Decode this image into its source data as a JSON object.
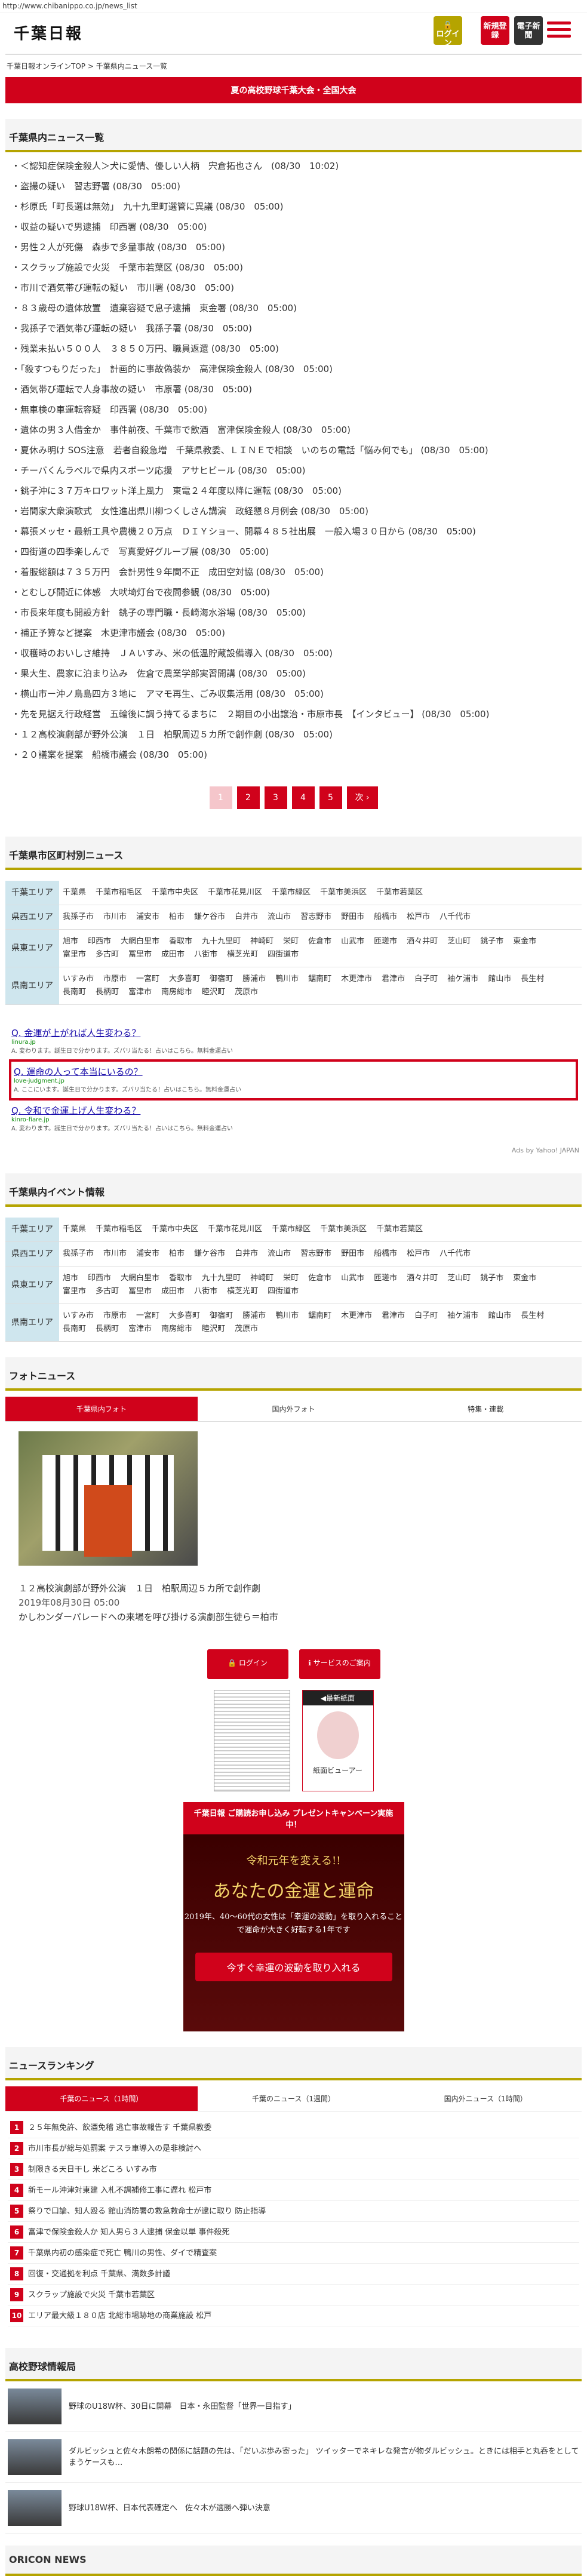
{
  "url": "http://www.chibanippo.co.jp/news_list",
  "header": {
    "logo": "千葉日報",
    "login": "ログイン",
    "register": "新規登録",
    "epaper": "電子新聞"
  },
  "breadcrumb": "千葉日報オンラインTOP > 千葉県内ニュース一覧",
  "banner": "夏の高校野球千葉大会・全国大会",
  "news_section": {
    "title": "千葉県内ニュース一覧",
    "items": [
      "＜認知症保険金殺人＞犬に愛情、優しい人柄　宍倉拓也さん　(08/30　10:02)",
      "盗撮の疑い　習志野署 (08/30　05:00)",
      "杉原氏「町長選は無効」　九十九里町選管に異議 (08/30　05:00)",
      "収益の疑いで男逮捕　印西署 (08/30　05:00)",
      "男性２人が死傷　森歩で多量事故 (08/30　05:00)",
      "スクラップ施設で火災　千葉市若葉区 (08/30　05:00)",
      "市川で酒気帯び運転の疑い　市川署 (08/30　05:00)",
      "８３歳母の遺体放置　遺棄容疑で息子逮捕　東金署 (08/30　05:00)",
      "我孫子で酒気帯び運転の疑い　我孫子署 (08/30　05:00)",
      "残業未払い５００人　３８５０万円、職員返還 (08/30　05:00)",
      "「殺すつもりだった」　計画的に事故偽装か　高津保険金殺人 (08/30　05:00)",
      "酒気帯び運転で人身事故の疑い　市原署 (08/30　05:00)",
      "無車検の車運転容疑　印西署 (08/30　05:00)",
      "遺体の男３人借金か　事件前夜、千葉市で飲酒　富津保険金殺人 (08/30　05:00)",
      "夏休み明け SOS注意　若者自殺急増　千葉県教委、ＬＩＮＥで相談　いのちの電話「悩み何でも」 (08/30　05:00)",
      "チーバくんラベルで県内スポーツ応援　アサヒビール (08/30　05:00)",
      "銚子沖に３７万キロワット洋上風力　東電２４年度以降に運転 (08/30　05:00)",
      "岩間家大衆演歌式　女性進出県川柳つくしさん講演　政経懇８月例会 (08/30　05:00)",
      "幕張メッセ・最新工具や農機２０万点　ＤＩＹショー、開幕４８５社出展　一般入場３０日から (08/30　05:00)",
      "四街道の四季楽しんで　写真愛好グループ展 (08/30　05:00)",
      "着服総額は７３５万円　会計男性９年間不正　成田空対協 (08/30　05:00)",
      "とむしび間近に体感　大吠埼灯台で夜間参観 (08/30　05:00)",
      "市長来年度も開設方針　銚子の専門職・長崎海水浴場 (08/30　05:00)",
      "補正予算など提案　木更津市議会 (08/30　05:00)",
      "収穫時のおいしさ維持　ＪＡいすみ、米の低温貯蔵設備導入 (08/30　05:00)",
      "果大生、農家に泊まり込み　佐倉で農業学部実習開講 (08/30　05:00)",
      "横山市ー沖ノ鳥島四方３地に　アマモ再生、ごみ収集活用 (08/30　05:00)",
      "先を見据え行政経営　五輪後に調う持てるまちに　２期目の小出譲治・市原市長　【インタビュー】 (08/30　05:00)",
      "１２高校演劇部が野外公演　１日　柏駅周辺５カ所で創作劇 (08/30　05:00)",
      "２０議案を提案　船橋市議会 (08/30　05:00)"
    ]
  },
  "pager": {
    "pages": [
      "1",
      "2",
      "3",
      "4",
      "5"
    ],
    "next": "次 ›"
  },
  "areas_section": {
    "title": "千葉県市区町村別ニュース",
    "rows": [
      {
        "label": "千葉エリア",
        "cities": [
          "千葉県",
          "千葉市稲毛区",
          "千葉市中央区",
          "千葉市花見川区",
          "千葉市緑区",
          "千葉市美浜区",
          "千葉市若葉区"
        ]
      },
      {
        "label": "県西エリア",
        "cities": [
          "我孫子市",
          "市川市",
          "浦安市",
          "柏市",
          "鎌ケ谷市",
          "白井市",
          "流山市",
          "習志野市",
          "野田市",
          "船橋市",
          "松戸市",
          "八千代市"
        ]
      },
      {
        "label": "県東エリア",
        "cities": [
          "旭市",
          "印西市",
          "大網白里市",
          "香取市",
          "九十九里町",
          "神崎町",
          "栄町",
          "佐倉市",
          "山武市",
          "匝瑳市",
          "酒々井町",
          "芝山町",
          "銚子市",
          "東金市",
          "富里市",
          "多古町",
          "冨里市",
          "成田市",
          "八街市",
          "横芝光町",
          "四街道市"
        ]
      },
      {
        "label": "県南エリア",
        "cities": [
          "いすみ市",
          "市原市",
          "一宮町",
          "大多喜町",
          "御宿町",
          "勝浦市",
          "鴨川市",
          "鋸南町",
          "木更津市",
          "君津市",
          "白子町",
          "袖ケ浦市",
          "館山市",
          "長生村",
          "長南町",
          "長柄町",
          "富津市",
          "南房総市",
          "睦沢町",
          "茂原市"
        ]
      }
    ]
  },
  "ads": {
    "items": [
      {
        "title": "Q. 金運が上がれば人生変わる？",
        "url": "linura.jp",
        "desc": "A. 変わります。誕生日で分かります。ズバリ当たる！占いはこちら。無料金運占い"
      },
      {
        "title": "Q. 運命の人って本当にいるの？",
        "url": "love-judgment.jp",
        "desc": "A. ここにいます。誕生日で分かります。ズバリ当たる！占いはこちら。無料金運占い"
      },
      {
        "title": "Q. 令和で金運上げ人生変わる？",
        "url": "kinro-fiare.jp",
        "desc": "A. 変わります。誕生日で分かります。ズバリ当たる！占いはこちら。無料金運占い"
      }
    ],
    "by": "Ads by Yahoo! JAPAN"
  },
  "events_section": {
    "title": "千葉県内イベント情報"
  },
  "photo_section": {
    "title": "フォトニュース",
    "tabs": [
      "千葉県内フォト",
      "国内外フォト",
      "特集・連載"
    ],
    "caption": "１２高校演劇部が野外公演　１日　柏駅周辺５カ所で創作劇",
    "date": "2019年08月30日 05:00",
    "sub": "かしわンダーパレードへの来場を呼び掛ける演劇部生徒ら＝柏市"
  },
  "side": {
    "login": "ログイン",
    "service": "サービスのご案内",
    "latest": "◀最新紙面",
    "viewer": "紙面ビューアー"
  },
  "promo": {
    "top": "千葉日報 ご購読お申し込み プレゼントキャンペーン実施中！",
    "l1": "令和元年を変える!!",
    "l2": "あなたの金運と運命",
    "l3": "2019年、40～60代の女性は「幸運の波動」を取り入れることで運命が大きく好転する1年です",
    "btn": "今すぐ幸運の波動を取り入れる"
  },
  "ranking": {
    "title": "ニュースランキング",
    "tabs": [
      "千葉のニュース（1時間）",
      "千葉のニュース（1週間）",
      "国内外ニュース（1時間）"
    ],
    "items": [
      "２５年無免許、飲酒免稽 逃亡事故報告す 千葉県教委",
      "市川市長が総与処罰案 テスラ車導入の是非検討へ",
      "制限きる天日干し 米どころ いすみ市",
      "新モール沖津対東建 入札不調補修工事に遅れ 松戸市",
      "祭りで口論、知人殴る 館山消防署の救急救命士が逮に取り 防止指導",
      "富津で保険金殺人か 知人男ら３人逮捕 保金以単 事件殺死",
      "千葉県内初の感染症で死亡 鴨川の男性、ダイで精査案",
      "回復・交通拠を利点 千葉県、満数多計議",
      "スクラップ施設で火災 千葉市若葉区",
      "エリア最大級１８０店 北総市場跡地の商業施設 松戸"
    ]
  },
  "hs_section": {
    "title": "高校野球情報局",
    "items": [
      "野球のU18W杯、30日に開幕　日本・永田監督「世界一目指す」",
      "ダルビッシュと佐々木朗希の関係に話題の先は、「だいぶ歩み寄った」 ツイッターでネキレな発言が物ダルビッシュ。ときには相手と丸呑をとしてまうケースも…",
      "野球U18W杯、日本代表確定へ　佐々木が選勝へ弾い決意"
    ]
  },
  "oricon": "ORICON NEWS"
}
